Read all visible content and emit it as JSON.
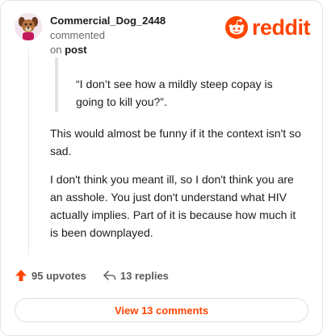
{
  "comment": {
    "author": "Commercial_Dog_2448",
    "action_text": "commented",
    "on_text": "on",
    "post_link": "post",
    "quote": "“I don’t see how a mildly steep copay is going to kill you?”.",
    "paragraphs": [
      "This would almost be funny if it the context isn't so sad.",
      "I don't think you meant ill, so I don't think you are an asshole. You just don't understand what HIV actually implies. Part of it is because how much it is been downplayed."
    ]
  },
  "brand": {
    "wordmark": "reddit",
    "accent_color": "#ff4500"
  },
  "stats": {
    "upvotes": "95 upvotes",
    "replies": "13 replies"
  },
  "footer": {
    "view_comments": "View 13 comments"
  },
  "icons": {
    "avatar": "dog-avatar-icon",
    "logo": "reddit-snoo-icon",
    "upvote": "upvote-arrow-icon",
    "reply": "reply-arrow-icon"
  }
}
